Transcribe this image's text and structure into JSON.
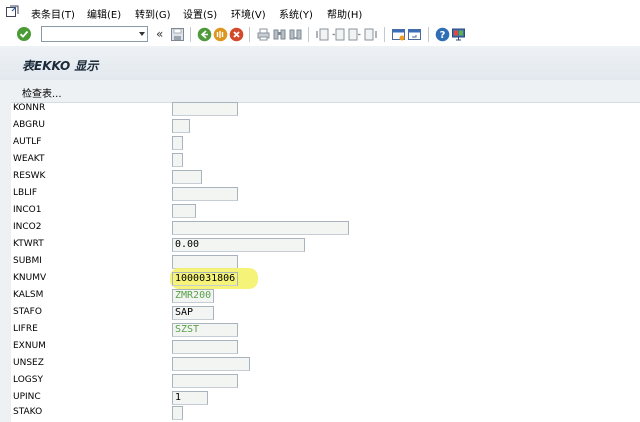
{
  "menu": {
    "items": [
      "表条目(T)",
      "编辑(E)",
      "转到(G)",
      "设置(S)",
      "环境(V)",
      "系统(Y)",
      "帮助(H)"
    ]
  },
  "toolbar": {
    "command_value": "",
    "double_chevron": "«",
    "icons": [
      "ok-icon",
      "save-icon",
      "back-icon",
      "exit-icon",
      "cancel-icon",
      "print-icon",
      "find-icon",
      "find-next-icon",
      "first-page-icon",
      "prev-page-icon",
      "next-page-icon",
      "last-page-icon",
      "create-session-icon",
      "shortcut-icon",
      "help-icon",
      "customize-layout-icon"
    ]
  },
  "title": "表EKKO 显示",
  "app_toolbar": {
    "check_label": "检查表..."
  },
  "fields": [
    {
      "label": "KONNR",
      "value": ""
    },
    {
      "label": "ABGRU",
      "value": ""
    },
    {
      "label": "AUTLF",
      "value": ""
    },
    {
      "label": "WEAKT",
      "value": ""
    },
    {
      "label": "RESWK",
      "value": ""
    },
    {
      "label": "LBLIF",
      "value": ""
    },
    {
      "label": "INCO1",
      "value": ""
    },
    {
      "label": "INCO2",
      "value": ""
    },
    {
      "label": "KTWRT",
      "value": "0.00"
    },
    {
      "label": "SUBMI",
      "value": ""
    },
    {
      "label": "KNUMV",
      "value": "1000031806"
    },
    {
      "label": "KALSM",
      "value": "ZMR200"
    },
    {
      "label": "STAFO",
      "value": "SAP"
    },
    {
      "label": "LIFRE",
      "value": "SZST"
    },
    {
      "label": "EXNUM",
      "value": ""
    },
    {
      "label": "UNSEZ",
      "value": ""
    },
    {
      "label": "LOGSY",
      "value": ""
    },
    {
      "label": "UPINC",
      "value": "1"
    },
    {
      "label": "STAKO",
      "value": ""
    }
  ],
  "colors": {
    "highlight": "#f4f36a",
    "link_value": "#5aa04a"
  }
}
